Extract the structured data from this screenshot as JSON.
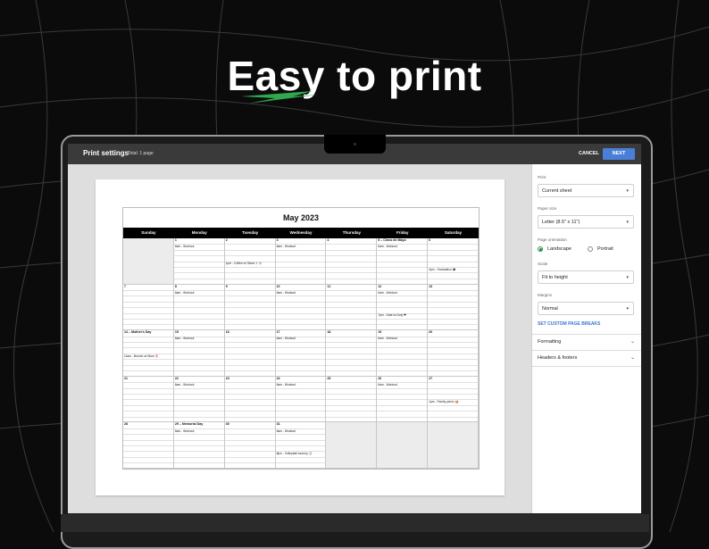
{
  "headline": {
    "word1": "Easy",
    "rest": " to print",
    "accent": "#2fa84f"
  },
  "dialog": {
    "title": "Print settings",
    "total": "Total: 1 page",
    "cancel": "CANCEL",
    "next": "NEXT"
  },
  "panel": {
    "print_label": "Print",
    "print_value": "Current sheet",
    "paper_label": "Paper size",
    "paper_value": "Letter (8.5\" x 11\")",
    "orientation_label": "Page orientation",
    "landscape": "Landscape",
    "portrait": "Portrait",
    "orientation_selected": "Landscape",
    "scale_label": "Scale",
    "scale_value": "Fit to height",
    "margins_label": "Margins",
    "margins_value": "Normal",
    "custom_breaks": "SET CUSTOM PAGE BREAKS",
    "formatting": "Formatting",
    "headers_footers": "Headers & footers"
  },
  "calendar": {
    "title": "May 2023",
    "days": [
      "Sunday",
      "Monday",
      "Tuesday",
      "Wednesday",
      "Thursday",
      "Friday",
      "Saturday"
    ],
    "weeks": [
      [
        {
          "n": "",
          "gray": true
        },
        {
          "n": "1"
        },
        {
          "n": "2"
        },
        {
          "n": "3"
        },
        {
          "n": "4"
        },
        {
          "n": "5 – Cinco de Mayo"
        },
        {
          "n": "6"
        }
      ],
      [
        {
          "n": "7"
        },
        {
          "n": "8"
        },
        {
          "n": "9"
        },
        {
          "n": "10"
        },
        {
          "n": "11"
        },
        {
          "n": "12"
        },
        {
          "n": "13"
        }
      ],
      [
        {
          "n": "14 – Mother's Day"
        },
        {
          "n": "15"
        },
        {
          "n": "16"
        },
        {
          "n": "17"
        },
        {
          "n": "18"
        },
        {
          "n": "19"
        },
        {
          "n": "20"
        }
      ],
      [
        {
          "n": "21"
        },
        {
          "n": "22"
        },
        {
          "n": "23"
        },
        {
          "n": "24"
        },
        {
          "n": "25"
        },
        {
          "n": "26"
        },
        {
          "n": "27"
        }
      ],
      [
        {
          "n": "28"
        },
        {
          "n": "29 – Memorial Day"
        },
        {
          "n": "30"
        },
        {
          "n": "31"
        },
        {
          "n": "",
          "gray": true
        },
        {
          "n": "",
          "gray": true
        },
        {
          "n": "",
          "gray": true
        }
      ]
    ],
    "events": [
      {
        "w": 0,
        "d": 1,
        "line": 1,
        "t": "6am - Workout"
      },
      {
        "w": 0,
        "d": 3,
        "line": 1,
        "t": "6am - Workout"
      },
      {
        "w": 0,
        "d": 5,
        "line": 1,
        "t": "6am - Workout"
      },
      {
        "w": 0,
        "d": 2,
        "line": 4,
        "t": "1pm - Coffee w/ Steve J. ☕"
      },
      {
        "w": 0,
        "d": 6,
        "line": 5,
        "t": "3pm - Graduation 🎓"
      },
      {
        "w": 1,
        "d": 1,
        "line": 1,
        "t": "6am - Workout"
      },
      {
        "w": 1,
        "d": 3,
        "line": 1,
        "t": "6am - Workout"
      },
      {
        "w": 1,
        "d": 5,
        "line": 1,
        "t": "6am - Workout"
      },
      {
        "w": 1,
        "d": 5,
        "line": 5,
        "t": "7pm - Date w/ Amy ❤"
      },
      {
        "w": 2,
        "d": 1,
        "line": 1,
        "t": "6am - Workout"
      },
      {
        "w": 2,
        "d": 3,
        "line": 1,
        "t": "6am - Workout"
      },
      {
        "w": 2,
        "d": 5,
        "line": 1,
        "t": "6am - Workout"
      },
      {
        "w": 2,
        "d": 0,
        "line": 4,
        "t": "11am - Brunch w/ Mom 🌷"
      },
      {
        "w": 3,
        "d": 1,
        "line": 1,
        "t": "6am - Workout"
      },
      {
        "w": 3,
        "d": 3,
        "line": 1,
        "t": "6am - Workout"
      },
      {
        "w": 3,
        "d": 5,
        "line": 1,
        "t": "6am - Workout"
      },
      {
        "w": 3,
        "d": 6,
        "line": 4,
        "t": "1pm - Family picnic 🧺"
      },
      {
        "w": 4,
        "d": 1,
        "line": 1,
        "t": "6am - Workout"
      },
      {
        "w": 4,
        "d": 3,
        "line": 1,
        "t": "6am - Workout"
      },
      {
        "w": 4,
        "d": 3,
        "line": 5,
        "t": "8pm - Volleyball tourney 🏐"
      }
    ]
  }
}
